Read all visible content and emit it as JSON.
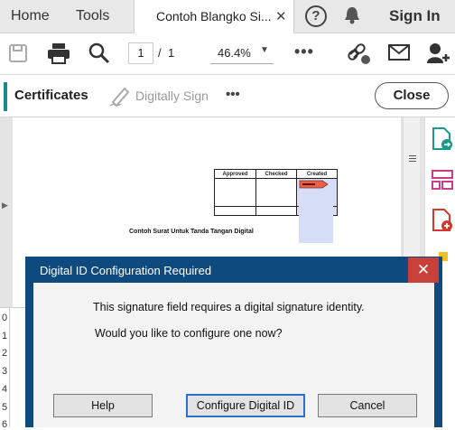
{
  "tabs": {
    "home": "Home",
    "tools": "Tools",
    "document": "Contoh Blangko Si...",
    "signin": "Sign In"
  },
  "toolbar": {
    "page_current": "1",
    "page_sep": "/",
    "page_total": "1",
    "zoom": "46.4%"
  },
  "certbar": {
    "title": "Certificates",
    "digitally_sign": "Digitally Sign",
    "close": "Close"
  },
  "document": {
    "table_headers": [
      "Approved",
      "Checked",
      "Created"
    ],
    "caption": "Contoh Surat Untuk Tanda Tangan Digital"
  },
  "sheet": {
    "row_numbers": [
      "0",
      "1",
      "2",
      "3",
      "4",
      "5",
      "6"
    ]
  },
  "dialog": {
    "title": "Digital ID Configuration Required",
    "message": "This signature field requires a digital signature identity.",
    "question": "Would you like to configure one now?",
    "help": "Help",
    "configure": "Configure Digital ID",
    "cancel": "Cancel",
    "close_glyph": "✕"
  },
  "colors": {
    "accent": "#1a8a8a",
    "dialog_frame": "#0f4a7f",
    "close_red": "#c7403a"
  }
}
